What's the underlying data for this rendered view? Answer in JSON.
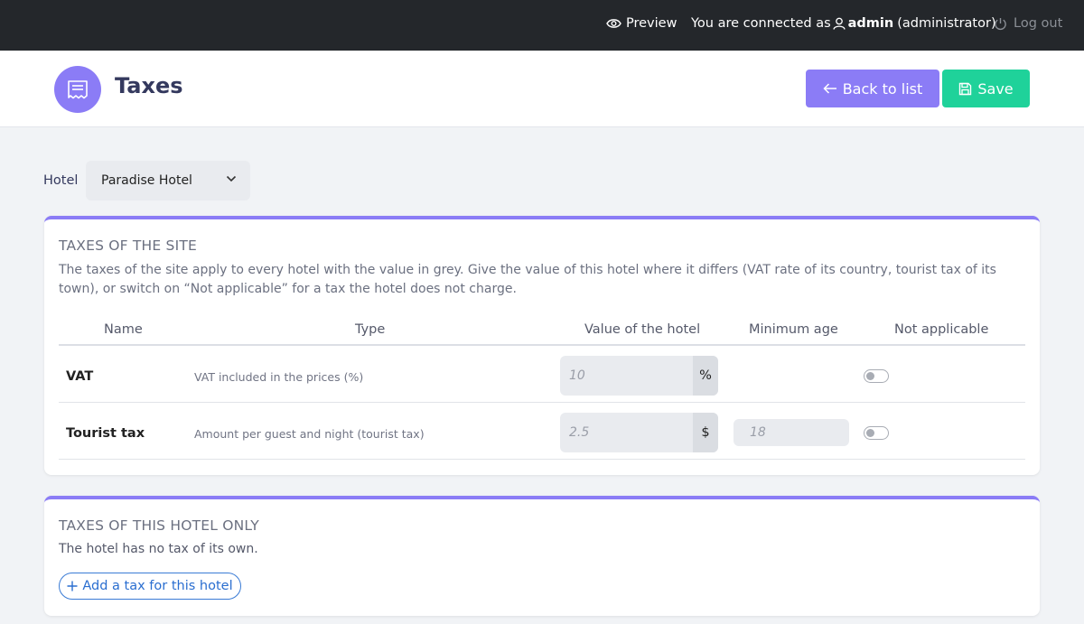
{
  "topbar": {
    "preview_label": "Preview",
    "connected_prefix": "You are connected as",
    "username": "admin",
    "role": "(administrator)",
    "logout_label": "Log out"
  },
  "header": {
    "title": "Taxes",
    "back_label": "Back to list",
    "save_label": "Save"
  },
  "hotel": {
    "label": "Hotel",
    "selected": "Paradise Hotel"
  },
  "site_taxes": {
    "title": "TAXES OF THE SITE",
    "description": "The taxes of the site apply to every hotel with the value in grey. Give the value of this hotel where it differs (VAT rate of its country, tourist tax of its town), or switch on “Not applicable” for a tax the hotel does not charge.",
    "columns": [
      "Name",
      "Type",
      "Value of the hotel",
      "Minimum age",
      "Not applicable"
    ],
    "rows": [
      {
        "name": "VAT",
        "type": "VAT included in the prices (%)",
        "value_placeholder": "10",
        "unit": "%",
        "min_age_placeholder": "",
        "not_applicable": false
      },
      {
        "name": "Tourist tax",
        "type": "Amount per guest and night (tourist tax)",
        "value_placeholder": "2.5",
        "unit": "$",
        "min_age_placeholder": "18",
        "not_applicable": false
      }
    ]
  },
  "hotel_taxes": {
    "title": "TAXES OF THIS HOTEL ONLY",
    "empty_text": "The hotel has no tax of its own.",
    "add_label": "Add a tax for this hotel"
  },
  "colors": {
    "accent": "#8b7cf6",
    "save": "#1fd29a",
    "topbar": "#24272b",
    "link": "#2a6ed0"
  }
}
